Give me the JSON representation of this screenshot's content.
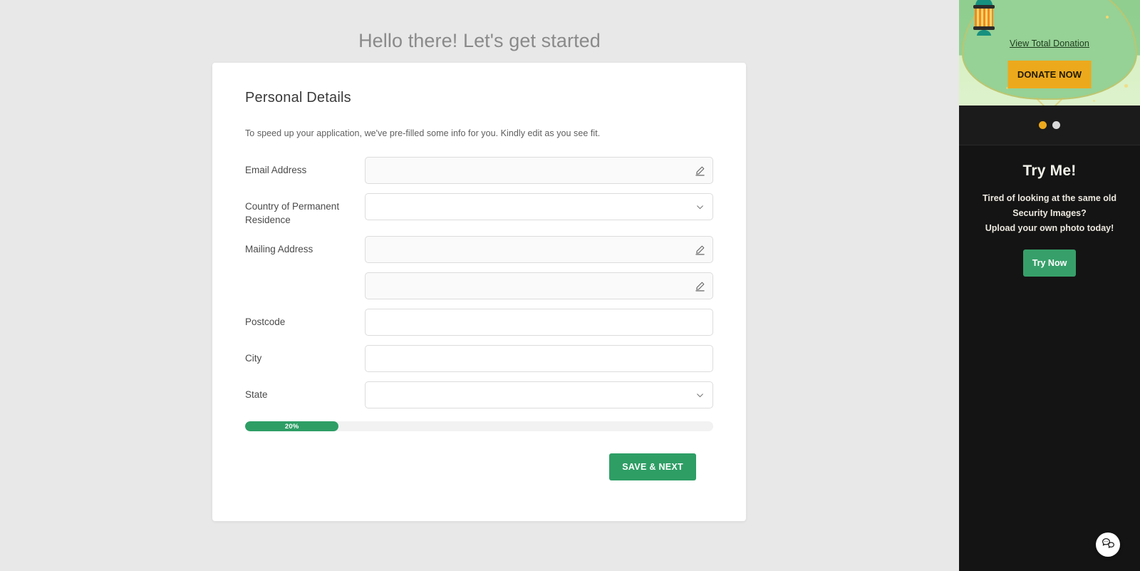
{
  "header": {
    "greeting": "Hello there! Let's get started"
  },
  "card": {
    "section_title": "Personal Details",
    "note": "To speed up your application, we've pre-filled some info for you. Kindly edit as you see fit.",
    "fields": [
      {
        "label": "Email Address",
        "type": "text",
        "value": "",
        "placeholder": "",
        "icon": "pencil-icon",
        "prefilled": true
      },
      {
        "label": "Country of Permanent Residence",
        "type": "select",
        "value": "",
        "placeholder": "",
        "icon": "chevron-down-icon",
        "prefilled": false
      },
      {
        "label": "Mailing Address",
        "type": "text",
        "value": "",
        "placeholder": "",
        "icon": "pencil-icon",
        "prefilled": true
      },
      {
        "label": "",
        "type": "text",
        "value": "",
        "placeholder": "",
        "icon": "pencil-icon",
        "prefilled": true
      },
      {
        "label": "Postcode",
        "type": "text",
        "value": "",
        "placeholder": "",
        "icon": "",
        "prefilled": false
      },
      {
        "label": "City",
        "type": "text",
        "value": "",
        "placeholder": "",
        "icon": "",
        "prefilled": false
      },
      {
        "label": "State",
        "type": "select",
        "value": "",
        "placeholder": "",
        "icon": "chevron-down-icon",
        "prefilled": false
      }
    ],
    "progress": {
      "percent": 20,
      "label": "20%"
    },
    "save_button": "SAVE & NEXT"
  },
  "sidebar": {
    "banner": {
      "link_label": "View Total Donation",
      "donate_button": "DONATE NOW"
    },
    "carousel": {
      "dots": [
        {
          "state": "active"
        },
        {
          "state": "inactive"
        }
      ]
    },
    "promo": {
      "title": "Try Me!",
      "line1": "Tired of looking at the same old",
      "line2": "Security Images?",
      "line3": "Upload your own photo today!",
      "button": "Try Now"
    }
  },
  "chat": {
    "icon": "chat-bubbles-icon"
  },
  "colors": {
    "page_background": "#e8e8e8",
    "card_background": "#ffffff",
    "accent_green": "#2e9e65",
    "accent_green_light": "#37a06a",
    "accent_orange": "#eda91c",
    "sidebar_dark": "#141414",
    "banner_green": "#93d092",
    "title_gray": "#8a8a8a"
  }
}
